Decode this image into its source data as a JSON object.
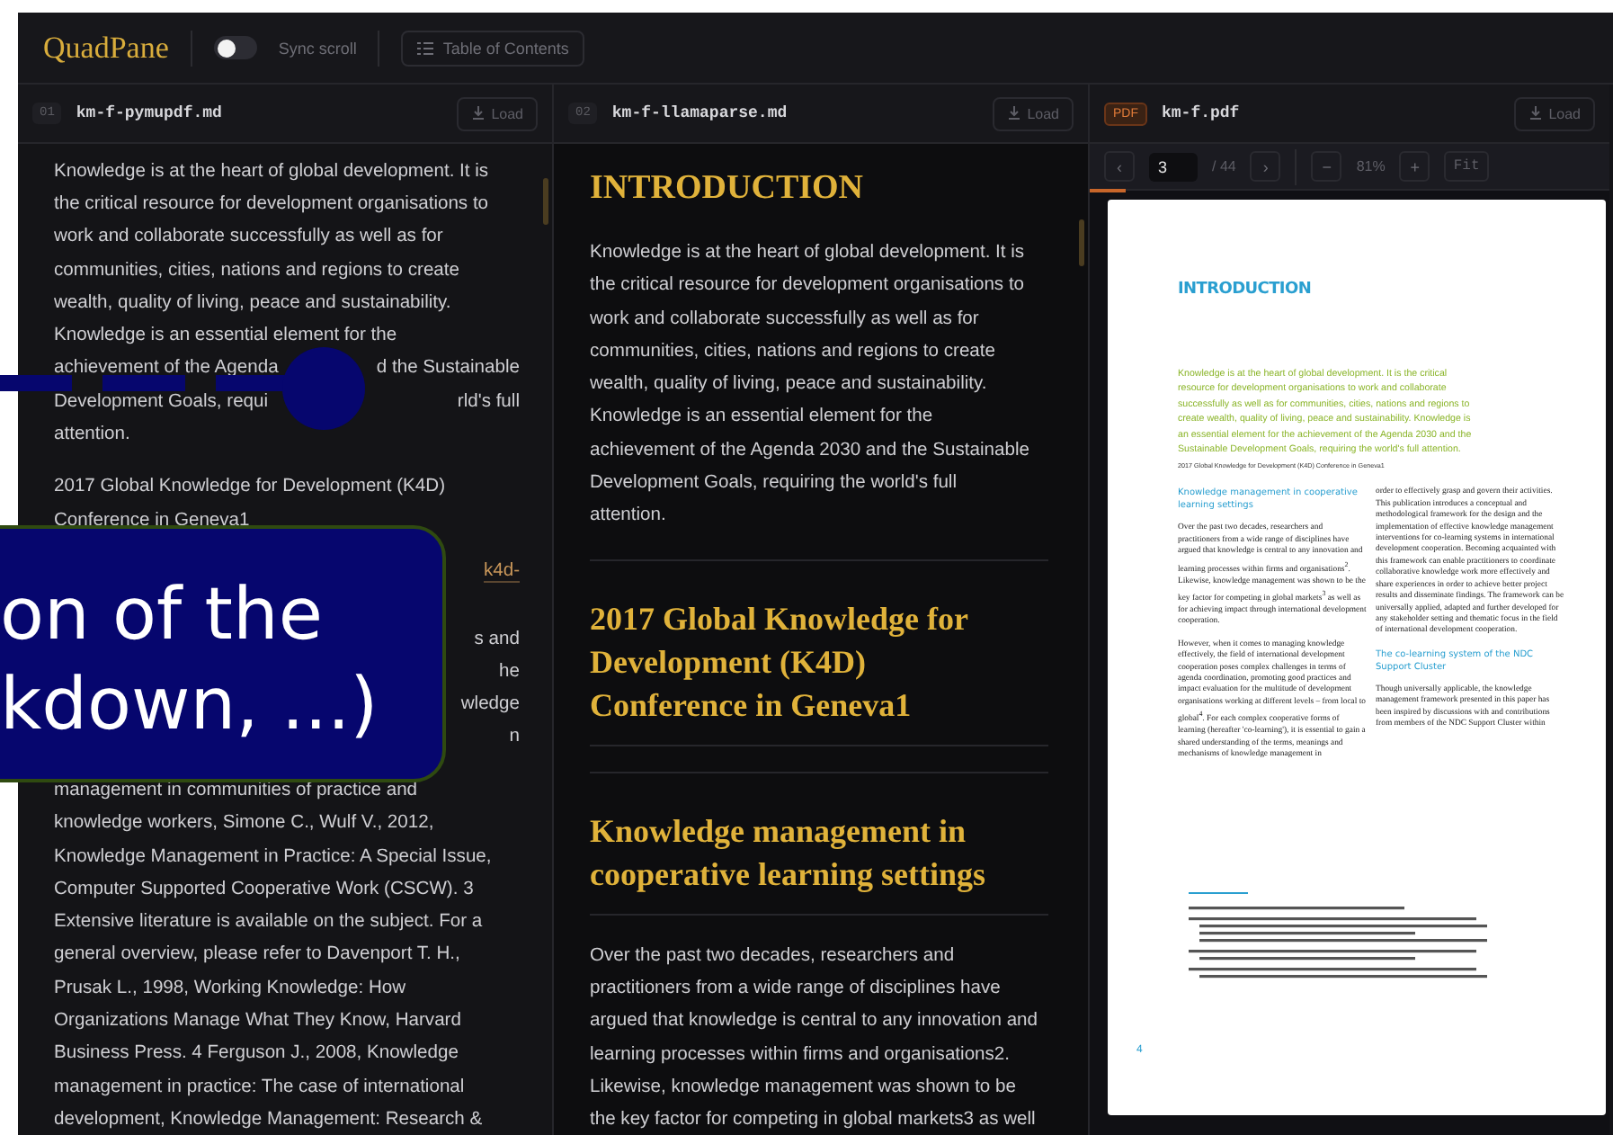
{
  "app": {
    "name": "QuadPane",
    "sync_scroll": {
      "label": "Sync scroll",
      "on": false
    },
    "toc_button": "Table of Contents"
  },
  "panes": [
    {
      "kind": "markdown",
      "index": "01",
      "file": "km-f-pymupdf.md",
      "load": "Load",
      "paragraphs": [
        [
          {
            "text": "Knowledge is at the heart of global development. It is"
          },
          {
            "text": "the critical resource for development organisations to"
          },
          {
            "text": "work and collaborate successfully as well as for"
          },
          {
            "text": "communities, cities, nations and regions to create"
          },
          {
            "text": "wealth, quality of living, peace and sustainability."
          },
          {
            "text": "Knowledge is an essential element for the"
          },
          {
            "text": "achievement of the Agenda",
            "tail": "d the Sustainable"
          },
          {
            "text": "Development Goals, requi",
            "tail": "rld's full"
          },
          {
            "text": "attention."
          }
        ],
        [
          {
            "text": "2017 Global Knowledge for Development (K4D)"
          },
          {
            "text": "Conference in Geneva1"
          }
        ],
        [
          {
            "tail": "k4d-",
            "link": true
          },
          {
            "tail": "s and"
          },
          {
            "tail": "he"
          },
          {
            "tail": "wledge"
          },
          {
            "tail": "n"
          }
        ],
        [
          {
            "text": "management in communities of practice and"
          },
          {
            "text": "knowledge workers, Simone C., Wulf V., 2012,"
          },
          {
            "text": "Knowledge Management in Practice: A Special Issue,"
          },
          {
            "text": "Computer Supported Cooperative Work (CSCW). 3"
          },
          {
            "text": "Extensive literature is available on the subject. For a"
          },
          {
            "text": "general overview, please refer to Davenport T. H.,"
          },
          {
            "text": "Prusak L., 1998, Working Knowledge: How"
          },
          {
            "text": "Organizations Manage What They Know, Harvard"
          },
          {
            "text": "Business Press. 4 Ferguson J., 2008, Knowledge"
          },
          {
            "text": "management in practice: The case of international"
          },
          {
            "text": "development, Knowledge Management: Research &"
          }
        ]
      ]
    },
    {
      "kind": "rendered",
      "index": "02",
      "file": "km-f-llamaparse.md",
      "load": "Load",
      "blocks": [
        {
          "kind": "h1",
          "lines": [
            "INTRODUCTION"
          ]
        },
        {
          "kind": "p",
          "lines": [
            "Knowledge is at the heart of global development. It is",
            "the critical resource for development organisations to",
            "work and collaborate successfully as well as for",
            "communities, cities, nations and regions to create",
            "wealth, quality of living, peace and sustainability.",
            "Knowledge is an essential element for the",
            "achievement of the Agenda 2030 and the Sustainable",
            "Development Goals, requiring the world's full",
            "attention."
          ]
        },
        {
          "kind": "h2",
          "lines": [
            "2017 Global Knowledge for",
            "Development (K4D)",
            "Conference in Geneva1"
          ]
        },
        {
          "kind": "h2",
          "lines": [
            "Knowledge management in",
            "cooperative learning settings"
          ]
        },
        {
          "kind": "p",
          "lines": [
            "Over the past two decades, researchers and",
            "practitioners from a wide range of disciplines have",
            "argued that knowledge is central to any innovation and",
            "learning processes within firms and organisations2.",
            "Likewise, knowledge management was shown to be",
            "the key factor for competing in global markets3 as well"
          ]
        }
      ]
    },
    {
      "kind": "pdf",
      "badge": "PDF",
      "file": "km-f.pdf",
      "load": "Load",
      "toolbar": {
        "prev": "‹",
        "page": "3",
        "total": "/ 44",
        "next": "›",
        "zoom_out": "−",
        "zoom": "81%",
        "zoom_in": "+",
        "fit": "Fit"
      },
      "progress": {
        "level": 0.07
      },
      "page": {
        "title": "INTRODUCTION",
        "lead": "Knowledge is at the heart of global development. It is the critical resource for development organisations to work and collaborate successfully as well as for communities, cities, nations and regions to create wealth, quality of living, peace and sustainability. Knowledge is an essential element for the achievement of the Agenda 2030 and the Sustainable Development Goals, requiring the world's full attention.",
        "source": "2017 Global Knowledge for Development (K4D) Conference in Geneva1",
        "columns": [
          [
            {
              "kind": "heading",
              "text": "Knowledge management in cooperative learning settings"
            },
            {
              "kind": "text",
              "text": "Over the past two decades, researchers and practitioners from a wide range of disciplines have argued that knowledge is central to any innovation and learning processes within firms and organisations$^{2}$. Likewise, knowledge management was shown to be the key factor for competing in global markets$^{3}$ as well as for achieving impact through international development cooperation."
            },
            {
              "kind": "text",
              "text": "However, when it comes to managing knowledge effectively, the field of international development cooperation poses complex challenges in terms of agenda coordination, promoting good practices and impact evaluation for the multitude of development organisations working at different levels – from local to global$^{4}$. For each complex cooperative forms of learning (hereafter 'co-learning'), it is essential to gain a shared understanding of the terms, meanings and mechanisms of knowledge management in"
            }
          ],
          [
            {
              "kind": "text",
              "text": "order to effectively grasp and govern their activities. This publication introduces a conceptual and methodological framework for the design and the implementation of effective knowledge management interventions for co-learning systems in international development cooperation. Becoming acquainted with this framework can enable practitioners to coordinate collaborative knowledge work more effectively and share experiences in order to achieve better project results and disseminate findings. The framework can be universally applied, adapted and further developed for any stakeholder setting and thematic focus in the field of international development cooperation."
            },
            {
              "kind": "heading",
              "text": "The co-learning system of the NDC Support Cluster"
            },
            {
              "kind": "text",
              "text": "Though universally applicable, the knowledge management framework presented in this paper has been inspired by discussions with and contributions from members of the NDC Support Cluster within"
            }
          ]
        ],
        "number": "4"
      }
    }
  ],
  "callout": {
    "lines": [
      "on of the",
      "kdown, ...)"
    ]
  }
}
